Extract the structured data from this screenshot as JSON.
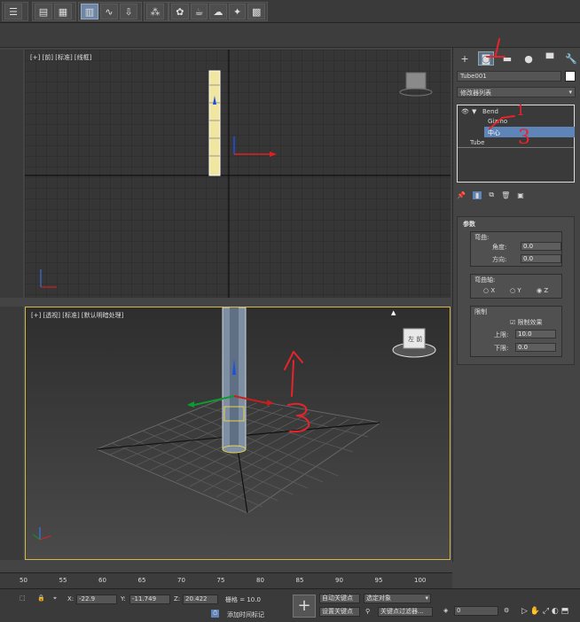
{
  "viewports": {
    "top": {
      "label": "[+] [前] [标准] [线框]"
    },
    "persp": {
      "label": "[+] [透视] [标准] [默认明暗处理]"
    }
  },
  "panel": {
    "object_name": "Tube001",
    "modifier_list": "修改器列表",
    "stack": {
      "bend": "Bend",
      "gizmo": "Gizmo",
      "center": "中心",
      "tube": "Tube"
    },
    "annotation_1": "1",
    "annotation_3": "3",
    "params_title": "参数",
    "bend_group": "弯曲:",
    "angle_label": "角度:",
    "angle_value": "0.0",
    "direction_label": "方向:",
    "direction_value": "0.0",
    "axis_group": "弯曲轴:",
    "axis_x": "X",
    "axis_y": "Y",
    "axis_z": "Z",
    "limits_group": "限制",
    "limit_effect": "限制效果",
    "upper_label": "上限:",
    "upper_value": "10.0",
    "lower_label": "下限:",
    "lower_value": "0.0"
  },
  "timeline": {
    "ticks": [
      "50",
      "55",
      "60",
      "65",
      "70",
      "75",
      "80",
      "85",
      "90",
      "95",
      "100"
    ]
  },
  "status": {
    "x_label": "X:",
    "x_value": "-22.9",
    "y_label": "Y:",
    "y_value": "-11.749",
    "z_label": "Z:",
    "z_value": "20.422",
    "grid": "栅格 = 10.0",
    "add_time_tag": "添加时间标记",
    "auto_key": "自动关键点",
    "set_key": "设置关键点",
    "selected": "选定对象",
    "key_filters": "关键点过滤器...",
    "frame": "0"
  },
  "persp_annotation": "3"
}
